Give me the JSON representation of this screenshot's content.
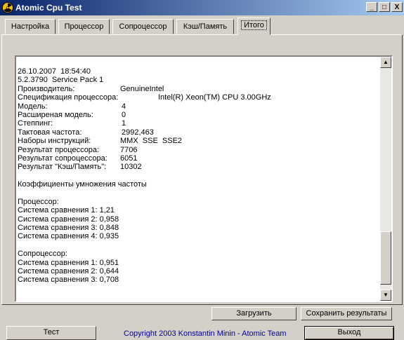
{
  "window": {
    "title": "Atomic Cpu Test",
    "minimize": "_",
    "maximize": "□",
    "close": "X"
  },
  "tabs": [
    {
      "label": "Настройка"
    },
    {
      "label": "Процессор"
    },
    {
      "label": "Сопроцессор"
    },
    {
      "label": "Кэш/Память"
    },
    {
      "label": "Итого"
    }
  ],
  "memo": {
    "date": "26.10.2007  18:54:40",
    "os": "5.2.3790  Service Pack 1",
    "fields": [
      {
        "label": "Производитель:",
        "value": "GenuineIntel"
      },
      {
        "label": "Спецификация процессора:",
        "value": "Intel(R) Xeon(TM) CPU 3.00GHz"
      },
      {
        "label": "Модель:",
        "value": "4"
      },
      {
        "label": "Расширеная модель:",
        "value": "0"
      },
      {
        "label": "Степпинг:",
        "value": "1"
      },
      {
        "label": "Тактовая частота:",
        "value": "2992,463"
      },
      {
        "label": "Наборы инструкций:",
        "value": "MMX  SSE  SSE2"
      },
      {
        "label": "Результат процессора:",
        "value": "7706"
      },
      {
        "label": "Результат сопроцессора:",
        "value": "6051"
      },
      {
        "label": "Результат \"Кэш/Память\":",
        "value": "10302"
      }
    ],
    "coef_header": "Коэффициенты умножения частоты",
    "cpu_header": "Процессор:",
    "cpu_lines": [
      "Система сравнения 1: 1,21",
      "Система сравнения 2: 0,958",
      "Система сравнения 3: 0,848",
      "Система сравнения 4: 0,935"
    ],
    "fpu_header": "Сопроцессор:",
    "fpu_lines": [
      "Система сравнения 1: 0,951",
      "Система сравнения 2: 0,644",
      "Система сравнения 3: 0,708"
    ]
  },
  "buttons": {
    "load": "Загрузить",
    "save": "Сохранить результаты",
    "test": "Тест",
    "exit": "Выход"
  },
  "copyright": "Copyright 2003 Konstantin Minin - Atomic Team"
}
